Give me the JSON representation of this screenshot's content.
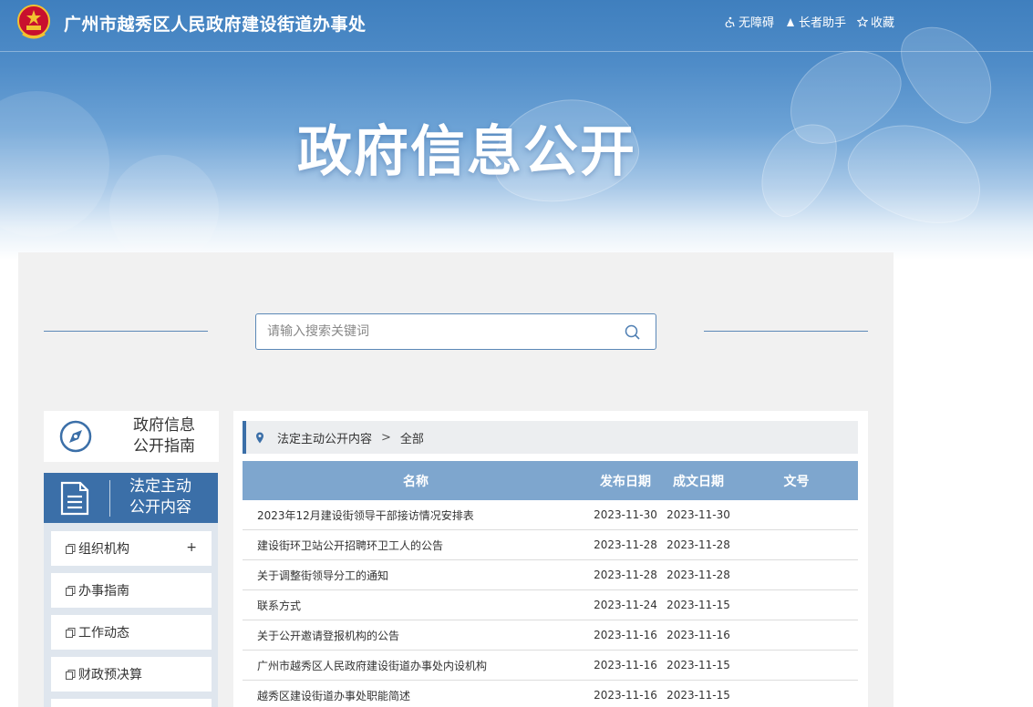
{
  "header": {
    "site_title": "广州市越秀区人民政府建设街道办事处",
    "links": [
      {
        "label": "无障碍",
        "icon": "accessibility-icon"
      },
      {
        "label": "长者助手",
        "icon": "elder-helper-icon"
      },
      {
        "label": "收藏",
        "icon": "star-icon"
      }
    ]
  },
  "hero": {
    "title": "政府信息公开"
  },
  "search": {
    "placeholder": "请输入搜索关键词",
    "icon": "search-icon"
  },
  "sidebar": {
    "guide": {
      "label": "政府信息公开指南",
      "icon": "compass-icon"
    },
    "active": {
      "label": "法定主动公开内容",
      "icon": "document-icon"
    },
    "items": [
      {
        "label": "组织机构",
        "expand": "+"
      },
      {
        "label": "办事指南"
      },
      {
        "label": "工作动态"
      },
      {
        "label": "财政预决算"
      }
    ]
  },
  "breadcrumb": {
    "parent": "法定主动公开内容",
    "separator": ">",
    "current": "全部"
  },
  "table": {
    "columns": [
      "名称",
      "发布日期",
      "成文日期",
      "文号"
    ],
    "rows": [
      {
        "name": "2023年12月建设街领导干部接访情况安排表",
        "published": "2023-11-30",
        "written": "2023-11-30",
        "doc_no": ""
      },
      {
        "name": "建设街环卫站公开招聘环卫工人的公告",
        "published": "2023-11-28",
        "written": "2023-11-28",
        "doc_no": ""
      },
      {
        "name": "关于调整街领导分工的通知",
        "published": "2023-11-28",
        "written": "2023-11-28",
        "doc_no": ""
      },
      {
        "name": "联系方式",
        "published": "2023-11-24",
        "written": "2023-11-15",
        "doc_no": ""
      },
      {
        "name": "关于公开邀请登报机构的公告",
        "published": "2023-11-16",
        "written": "2023-11-16",
        "doc_no": ""
      },
      {
        "name": "广州市越秀区人民政府建设街道办事处内设机构",
        "published": "2023-11-16",
        "written": "2023-11-15",
        "doc_no": ""
      },
      {
        "name": "越秀区建设街道办事处职能简述",
        "published": "2023-11-16",
        "written": "2023-11-15",
        "doc_no": ""
      }
    ]
  },
  "colors": {
    "header_blue": "#3f7fbe",
    "active_blue": "#3b6fa8",
    "table_header": "#7ea6ce",
    "panel_bg": "#f1f1f1"
  }
}
